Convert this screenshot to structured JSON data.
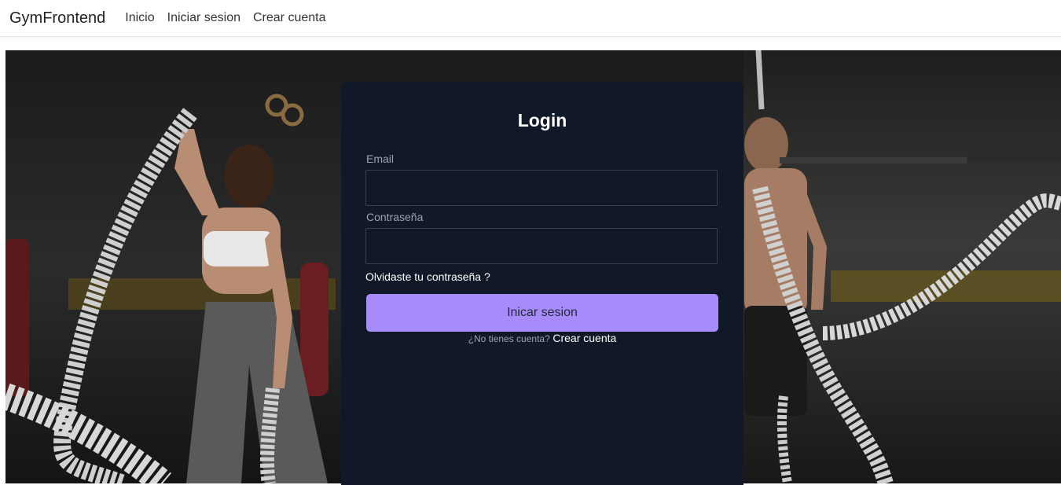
{
  "navbar": {
    "brand": "GymFrontend",
    "links": [
      "Inicio",
      "Iniciar sesion",
      "Crear cuenta"
    ]
  },
  "login": {
    "title": "Login",
    "email_label": "Email",
    "email_value": "",
    "password_label": "Contraseña",
    "password_value": "",
    "forgot_label": "Olvidaste tu contraseña ?",
    "submit_label": "Inicar sesion",
    "signup_question": "¿No tienes cuenta?",
    "signup_link": "Crear cuenta"
  },
  "colors": {
    "card_bg": "#111827",
    "accent": "#a78bfa",
    "navbar_bg": "#ffffff"
  },
  "hero": {
    "image": "gym-battle-ropes-photo"
  }
}
